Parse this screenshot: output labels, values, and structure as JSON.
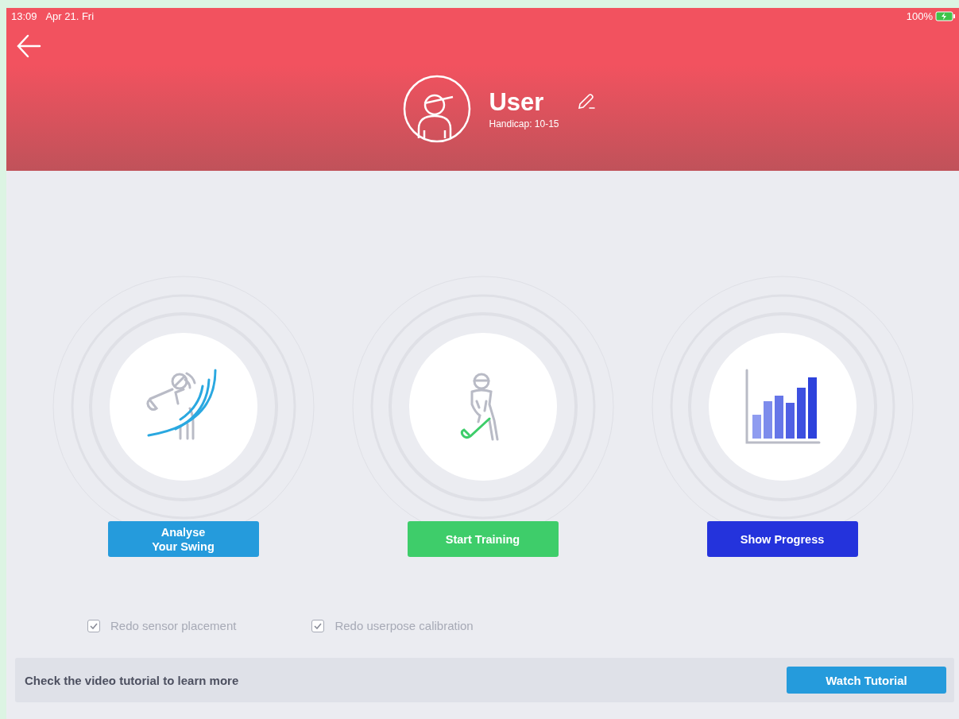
{
  "status_bar": {
    "time": "13:09",
    "date": "Apr 21. Fri",
    "battery": "100%"
  },
  "profile": {
    "name": "User",
    "handicap": "Handicap: 10-15"
  },
  "actions": [
    {
      "kind": "swing",
      "label": "Analyse\nYour Swing",
      "color": "#259bdc"
    },
    {
      "kind": "training",
      "label": "Start Training",
      "color": "#3ecd6a"
    },
    {
      "kind": "progress",
      "label": "Show Progress",
      "color": "#2433dc"
    }
  ],
  "options": [
    {
      "label": "Redo sensor placement",
      "checked": true
    },
    {
      "label": "Redo userpose calibration",
      "checked": true
    }
  ],
  "tutorial_bar": {
    "text": "Check the video tutorial to learn more",
    "button": "Watch Tutorial"
  }
}
